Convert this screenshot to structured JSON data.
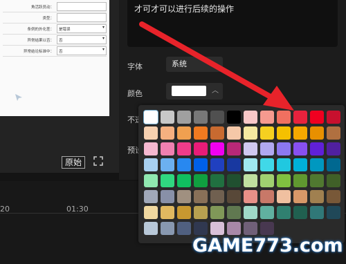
{
  "preview": {
    "rows": [
      {
        "label": "角活跃员动：",
        "value": "",
        "select": false
      },
      {
        "label": "类型：",
        "value": "",
        "select": false
      },
      {
        "label": "条例的外化差：",
        "value": "是错误",
        "select": true
      },
      {
        "label": "异常结果以否：",
        "value": "否",
        "select": true
      },
      {
        "label": "异常结论标准中：",
        "value": "否",
        "select": true
      }
    ],
    "original_button": "原始"
  },
  "panel": {
    "text_content": "才可才可以进行后续的操作",
    "font_label": "字体",
    "font_value": "系统",
    "color_label": "颜色",
    "opacity_label": "不透",
    "preset_label": "预设"
  },
  "timeline": {
    "ticks": [
      "20",
      "01:30"
    ]
  },
  "palette": {
    "selected_index": 0,
    "colors": [
      "#ffffff",
      "#c8c8c8",
      "#a0a0a0",
      "#787878",
      "#505050",
      "#000000",
      "#f9c8c8",
      "#f59a8f",
      "#f07060",
      "#e8223d",
      "#f00020",
      "#c8102e",
      "#f5d0b0",
      "#f5b080",
      "#f0a050",
      "#f07a20",
      "#c86a30",
      "#f5c8a8",
      "#f5e8a0",
      "#f5d020",
      "#f5c000",
      "#f5a800",
      "#e89000",
      "#b07040",
      "#f5b8d0",
      "#f080b0",
      "#f03c8a",
      "#e81c78",
      "#f000f0",
      "#b82878",
      "#d0c8f0",
      "#b0a8f0",
      "#8c78f0",
      "#8850f0",
      "#6020d8",
      "#5020a0",
      "#a8d0f0",
      "#6cb0f0",
      "#2888f0",
      "#0060e8",
      "#2040c0",
      "#1838a0",
      "#a0e8f0",
      "#40d8e8",
      "#20c8e0",
      "#00b0d8",
      "#0098c0",
      "#006890",
      "#90e8b0",
      "#30d880",
      "#10c060",
      "#10a040",
      "#207040",
      "#205030",
      "#c0e0a0",
      "#a0d070",
      "#80c040",
      "#609830",
      "#507830",
      "#406028",
      "#a0a8b8",
      "#8890a8",
      "#a09080",
      "#887058",
      "#706050",
      "#584838",
      "#e89088",
      "#c87868",
      "#f0c0a0",
      "#d89868",
      "#a08050",
      "#785838",
      "#f0d8a0",
      "#e0b860",
      "#c89830",
      "#b8a050",
      "#809858",
      "#607850",
      "#a0d8c8",
      "#60b0a0",
      "#308070",
      "#206050",
      "#307878",
      "#204858",
      "#b8c8d8",
      "#8898b0",
      "#506080",
      "#303850",
      "#d8c0d8",
      "#a888a8",
      "#706078",
      "#483850",
      "",
      "",
      "",
      ""
    ]
  },
  "watermark": "GAME773.com",
  "colors": {
    "arrow": "#e8232a",
    "panel_bg": "#1c1c1c",
    "palette_bg": "#2a2a2a"
  }
}
